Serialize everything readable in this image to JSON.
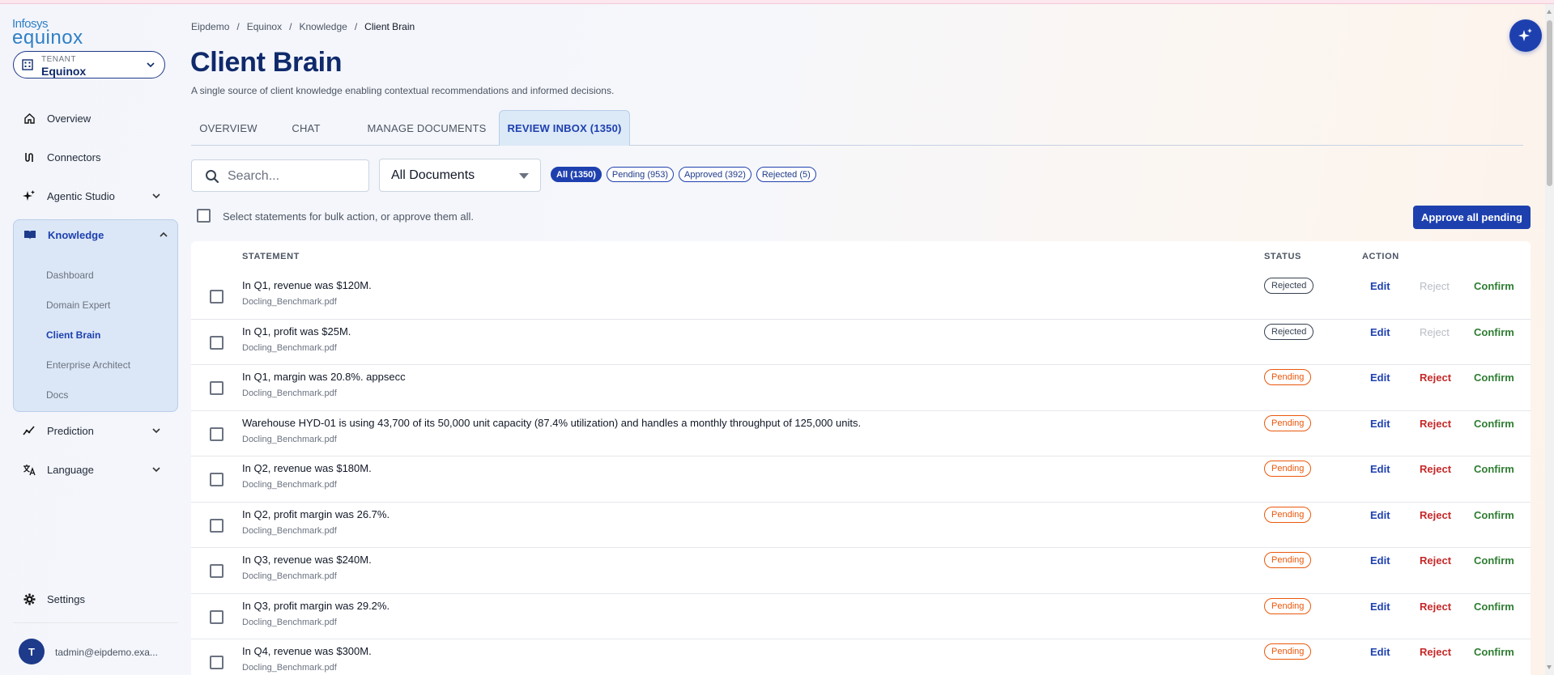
{
  "brand": {
    "line1": "Infosys",
    "line2": "equinox"
  },
  "tenant": {
    "label": "TENANT",
    "value": "Equinox"
  },
  "nav": {
    "overview": "Overview",
    "connectors": "Connectors",
    "agentic_studio": "Agentic Studio",
    "knowledge": "Knowledge",
    "knowledge_sub": [
      "Dashboard",
      "Domain Expert",
      "Client Brain",
      "Enterprise Architect",
      "Docs"
    ],
    "prediction": "Prediction",
    "language": "Language",
    "settings": "Settings"
  },
  "user": {
    "initial": "T",
    "email": "tadmin@eipdemo.exa..."
  },
  "breadcrumb": [
    "Eipdemo",
    "Equinox",
    "Knowledge",
    "Client Brain"
  ],
  "page": {
    "title": "Client Brain",
    "subtitle": "A single source of client knowledge enabling contextual recommendations and informed decisions."
  },
  "tabs": [
    "OVERVIEW",
    "CHAT",
    "MANAGE DOCUMENTS",
    "REVIEW INBOX (1350)"
  ],
  "search": {
    "placeholder": "Search..."
  },
  "doc_filter": {
    "value": "All Documents"
  },
  "chips": [
    "All (1350)",
    "Pending (953)",
    "Approved (392)",
    "Rejected (5)"
  ],
  "bulk": {
    "text": "Select statements for bulk action, or approve them all.",
    "approve_all": "Approve all pending"
  },
  "table": {
    "headers": {
      "statement": "STATEMENT",
      "status": "STATUS",
      "action": "ACTION"
    },
    "actions": {
      "edit": "Edit",
      "reject": "Reject",
      "confirm": "Confirm"
    },
    "rows": [
      {
        "statement": "In Q1, revenue was $120M.",
        "source": "Docling_Benchmark.pdf",
        "status": "Rejected"
      },
      {
        "statement": "In Q1, profit was $25M.",
        "source": "Docling_Benchmark.pdf",
        "status": "Rejected"
      },
      {
        "statement": "In Q1, margin was 20.8%. appsecc",
        "source": "Docling_Benchmark.pdf",
        "status": "Pending"
      },
      {
        "statement": "Warehouse HYD-01 is using 43,700 of its 50,000 unit capacity (87.4% utilization) and handles a monthly throughput of 125,000 units.",
        "source": "Docling_Benchmark.pdf",
        "status": "Pending"
      },
      {
        "statement": "In Q2, revenue was $180M.",
        "source": "Docling_Benchmark.pdf",
        "status": "Pending"
      },
      {
        "statement": "In Q2, profit margin was 26.7%.",
        "source": "Docling_Benchmark.pdf",
        "status": "Pending"
      },
      {
        "statement": "In Q3, revenue was $240M.",
        "source": "Docling_Benchmark.pdf",
        "status": "Pending"
      },
      {
        "statement": "In Q3, profit margin was 29.2%.",
        "source": "Docling_Benchmark.pdf",
        "status": "Pending"
      },
      {
        "statement": "In Q4, revenue was $300M.",
        "source": "Docling_Benchmark.pdf",
        "status": "Pending"
      }
    ]
  },
  "colors": {
    "primary": "#1e40af",
    "reject": "#c62828",
    "confirm": "#2e7d32",
    "pending": "#ea580c"
  }
}
